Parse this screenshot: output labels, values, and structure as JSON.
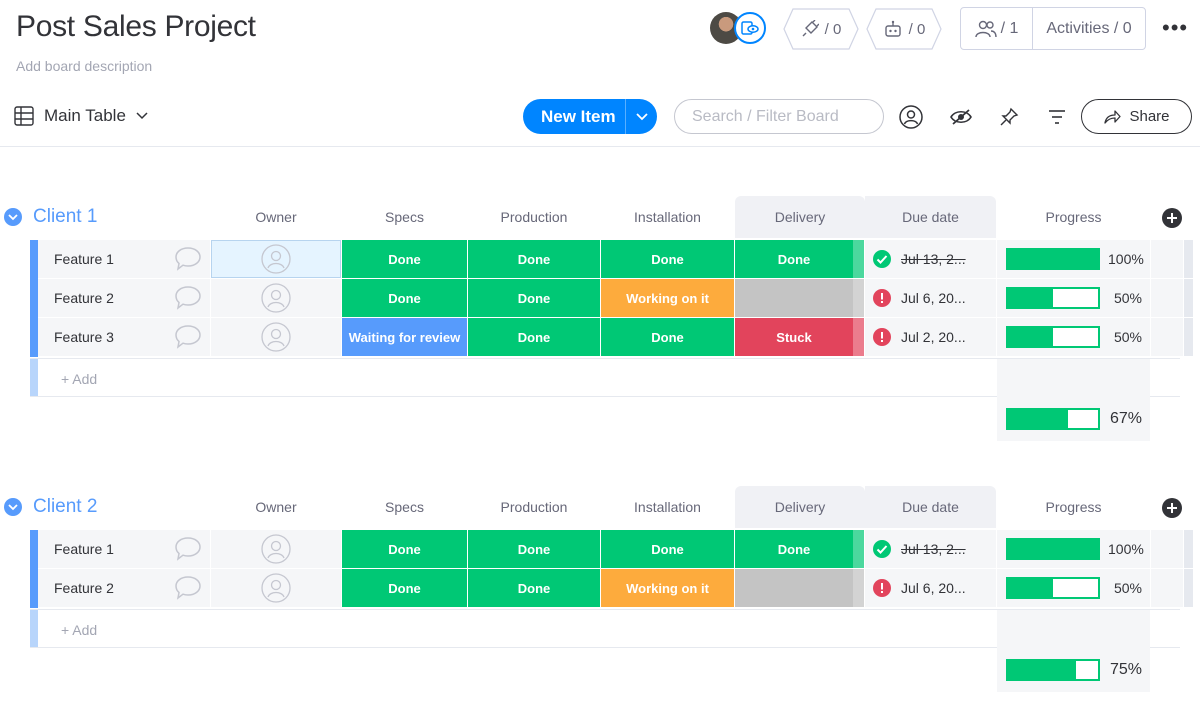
{
  "board": {
    "title": "Post Sales Project",
    "description": "Add board description"
  },
  "header": {
    "integrations_count": "/ 0",
    "automations_count": "/ 0",
    "members_count": "/ 1",
    "activities_label": "Activities / 0"
  },
  "toolbar": {
    "view_label": "Main Table",
    "new_item_label": "New Item",
    "search_placeholder": "Search / Filter Board",
    "share_label": "Share"
  },
  "columns": [
    "Owner",
    "Specs",
    "Production",
    "Installation",
    "Delivery",
    "Due date",
    "Progress"
  ],
  "groups": [
    {
      "title": "Client 1",
      "color": "#579bfc",
      "add_label": "+ Add",
      "summary_progress": "67%",
      "summary_fraction": 0.67,
      "rows": [
        {
          "name": "Feature 1",
          "specs": "Done",
          "production": "Done",
          "installation": "Done",
          "delivery": "Done",
          "due": "Jul 13, 2...",
          "due_status": "done",
          "progress": "100%",
          "progress_fraction": 1.0
        },
        {
          "name": "Feature 2",
          "specs": "Done",
          "production": "Done",
          "installation": "Working on it",
          "delivery": "",
          "due": "Jul 6, 20...",
          "due_status": "overdue",
          "progress": "50%",
          "progress_fraction": 0.5
        },
        {
          "name": "Feature 3",
          "specs": "Waiting for review",
          "production": "Done",
          "installation": "Done",
          "delivery": "Stuck",
          "due": "Jul 2, 20...",
          "due_status": "overdue",
          "progress": "50%",
          "progress_fraction": 0.5
        }
      ]
    },
    {
      "title": "Client 2",
      "color": "#579bfc",
      "add_label": "+ Add",
      "summary_progress": "75%",
      "summary_fraction": 0.75,
      "rows": [
        {
          "name": "Feature 1",
          "specs": "Done",
          "production": "Done",
          "installation": "Done",
          "delivery": "Done",
          "due": "Jul 13, 2...",
          "due_status": "done",
          "progress": "100%",
          "progress_fraction": 1.0
        },
        {
          "name": "Feature 2",
          "specs": "Done",
          "production": "Done",
          "installation": "Working on it",
          "delivery": "",
          "due": "Jul 6, 20...",
          "due_status": "overdue",
          "progress": "50%",
          "progress_fraction": 0.5
        }
      ]
    }
  ],
  "status_colors": {
    "Done": "#00c875",
    "Working on it": "#fdab3d",
    "Stuck": "#e2445c",
    "Waiting for review": "#579bfc",
    "": "#c4c4c4"
  },
  "icons": {
    "view": "table-icon",
    "search": "search-icon",
    "person_filter": "person-icon",
    "hide": "eye-off-icon",
    "pin": "pin-icon",
    "filter": "filter-icon",
    "share": "share-arrow-icon",
    "chat": "chat-bubble-icon",
    "owner": "user-avatar-icon"
  }
}
